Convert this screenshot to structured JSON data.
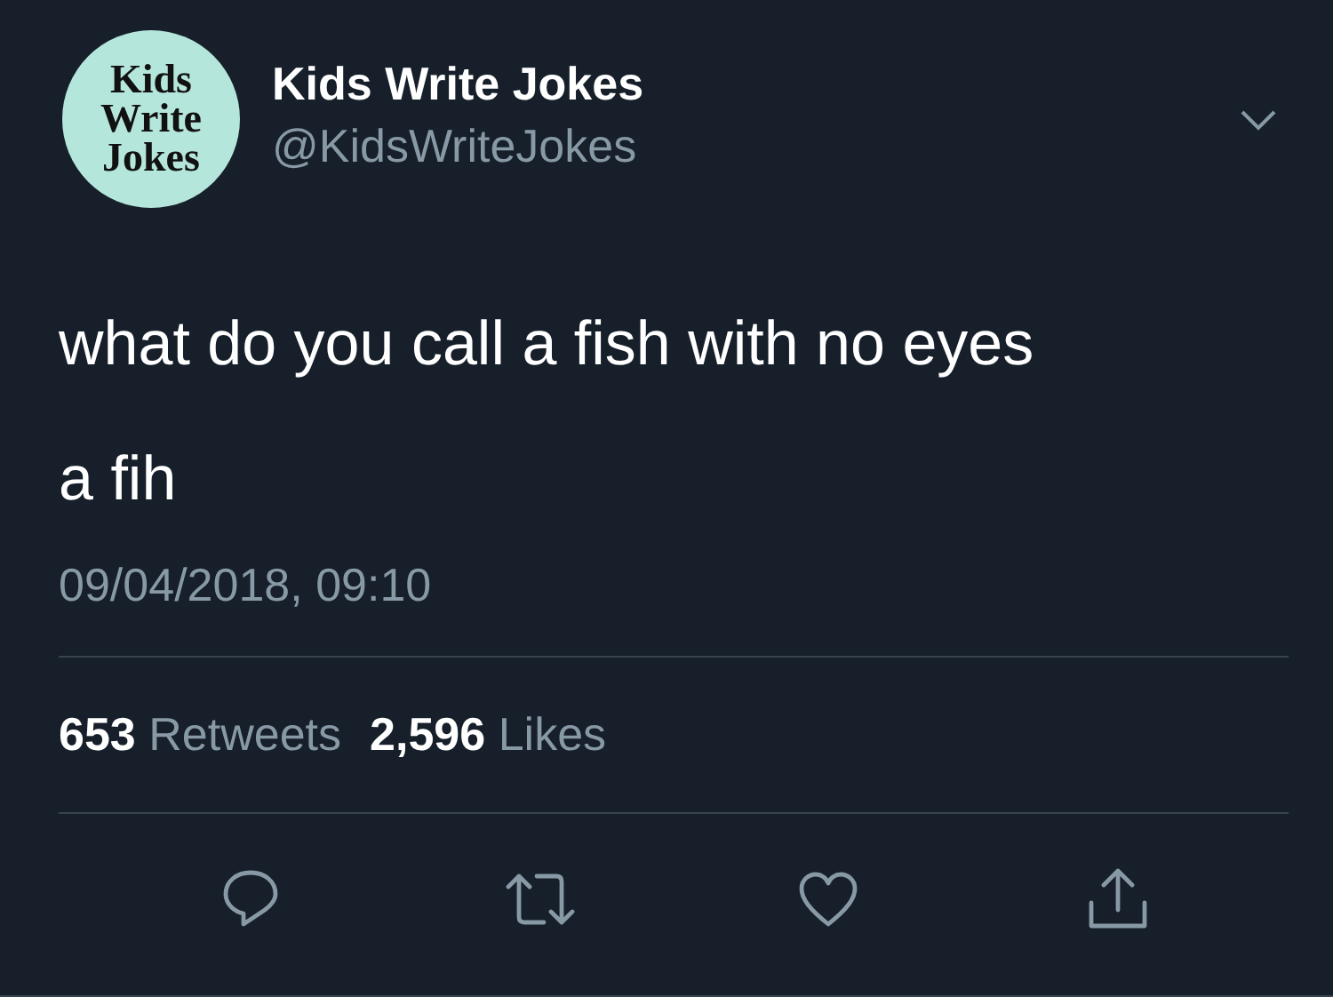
{
  "author": {
    "avatar_lines": [
      "Kids",
      "Write",
      "Jokes"
    ],
    "name": "Kids Write Jokes",
    "handle": "@KidsWriteJokes"
  },
  "tweet": {
    "paragraphs": [
      "what do you call a fish with no eyes",
      "a fih"
    ],
    "timestamp": "09/04/2018, 09:10"
  },
  "stats": [
    {
      "count": "653",
      "label": "Retweets"
    },
    {
      "count": "2,596",
      "label": "Likes"
    }
  ],
  "actions": [
    {
      "kind": "reply"
    },
    {
      "kind": "retweet"
    },
    {
      "kind": "like"
    },
    {
      "kind": "share"
    }
  ]
}
